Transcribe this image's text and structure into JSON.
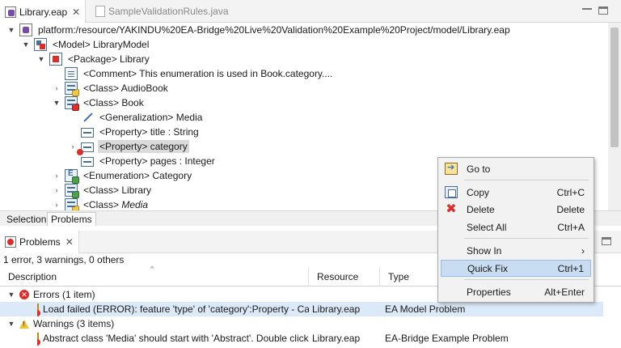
{
  "editor_tabs": [
    {
      "label": "Library.eap",
      "active": true
    },
    {
      "label": "SampleValidationRules.java",
      "active": false
    }
  ],
  "tree": {
    "resource": "platform:/resource/YAKINDU%20EA-Bridge%20Live%20Validation%20Example%20Project/model/Library.eap",
    "model": "<Model> LibraryModel",
    "package": "<Package> Library",
    "comment": "<Comment> This enumeration is used in Book.category....",
    "class_audiobook": "<Class> AudioBook",
    "class_book": "<Class> Book",
    "generalization": "<Generalization> Media",
    "prop_title": "<Property> title : String",
    "prop_category": "<Property> category",
    "prop_pages": "<Property> pages : Integer",
    "enumeration": "<Enumeration> Category",
    "class_library": "<Class> Library",
    "class_media_kw": "<Class>",
    "class_media_name": "Media"
  },
  "view_tabs": {
    "selection": "Selection",
    "problems": "Problems"
  },
  "problems": {
    "tab_label": "Problems",
    "summary": "1 error, 3 warnings, 0 others",
    "columns": [
      "Description",
      "Resource",
      "Type"
    ],
    "errors_group": "Errors (1 item)",
    "error_row": {
      "description": "Load failed (ERROR): feature 'type' of 'category':Property - Category",
      "resource": "Library.eap",
      "type": "EA Model Problem"
    },
    "warnings_group": "Warnings (3 items)",
    "warning_row": {
      "description": "Abstract class 'Media' should start with 'Abstract'. Double click to fix",
      "resource": "Library.eap",
      "type": "EA-Bridge Example Problem"
    }
  },
  "context_menu": {
    "goto": "Go to",
    "copy": "Copy",
    "copy_shortcut": "Ctrl+C",
    "delete": "Delete",
    "delete_shortcut": "Delete",
    "select_all": "Select All",
    "select_all_shortcut": "Ctrl+A",
    "show_in": "Show In",
    "show_in_arrow": "›",
    "quick_fix": "Quick Fix",
    "quick_fix_shortcut": "Ctrl+1",
    "properties": "Properties",
    "properties_shortcut": "Alt+Enter"
  },
  "colors": {
    "selection": "#dbe9f8",
    "menu_highlight": "#c8dcf2",
    "error": "#d9302c",
    "warning": "#f2c330"
  }
}
